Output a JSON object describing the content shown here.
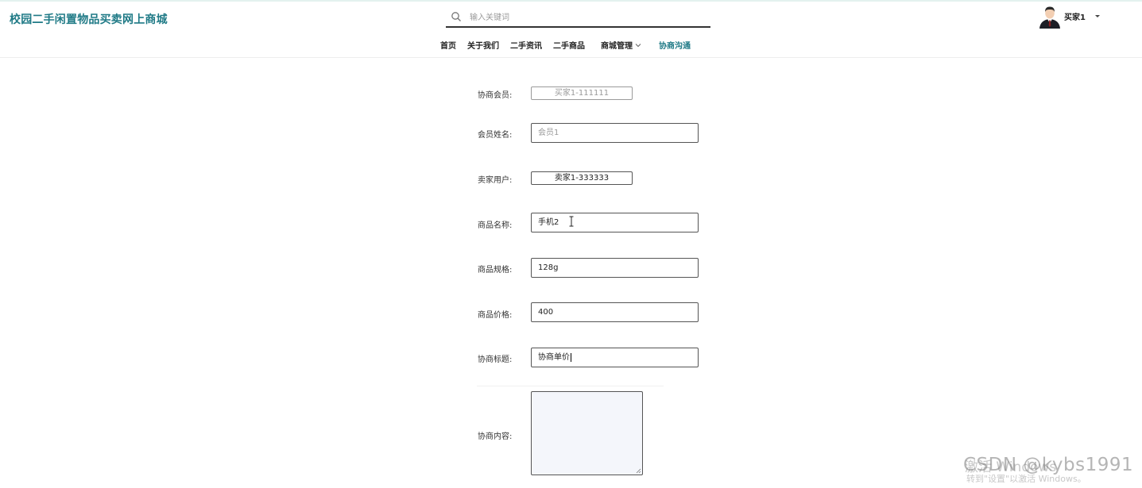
{
  "site": {
    "title": "校园二手闲置物品买卖网上商城"
  },
  "search": {
    "placeholder": "输入关键词",
    "value": ""
  },
  "nav": {
    "items": [
      {
        "label": "首页"
      },
      {
        "label": "关于我们"
      },
      {
        "label": "二手资讯"
      },
      {
        "label": "二手商品"
      },
      {
        "label": "商城管理"
      },
      {
        "label": "协商沟通"
      }
    ],
    "active_index": 5,
    "active_color": "#1f7a86"
  },
  "user": {
    "name": "买家1"
  },
  "form": {
    "member_label": "协商会员:",
    "member_value": "买家1-111111",
    "member_name_label": "会员姓名:",
    "member_name_value": "会员1",
    "seller_label": "卖家用户:",
    "seller_value": "卖家1-333333",
    "product_name_label": "商品名称:",
    "product_name_value": "手机2",
    "product_spec_label": "商品规格:",
    "product_spec_value": "128g",
    "product_price_label": "商品价格:",
    "product_price_value": "400",
    "title_label": "协商标题:",
    "title_value": "协商单价",
    "content_label": "协商内容:",
    "content_value": ""
  },
  "watermark": {
    "activate_line1": "激活 Windows",
    "activate_line2": "转到\"设置\"以激活 Windows。",
    "csdn": "CSDN @kybs1991"
  },
  "colors": {
    "brand": "#1f7a86",
    "textarea_bg": "#f4f6fb"
  },
  "icons": {
    "search": "magnifier",
    "chevron": "chevron-down",
    "avatar": "user-avatar",
    "cursor": "i-beam-cursor"
  }
}
